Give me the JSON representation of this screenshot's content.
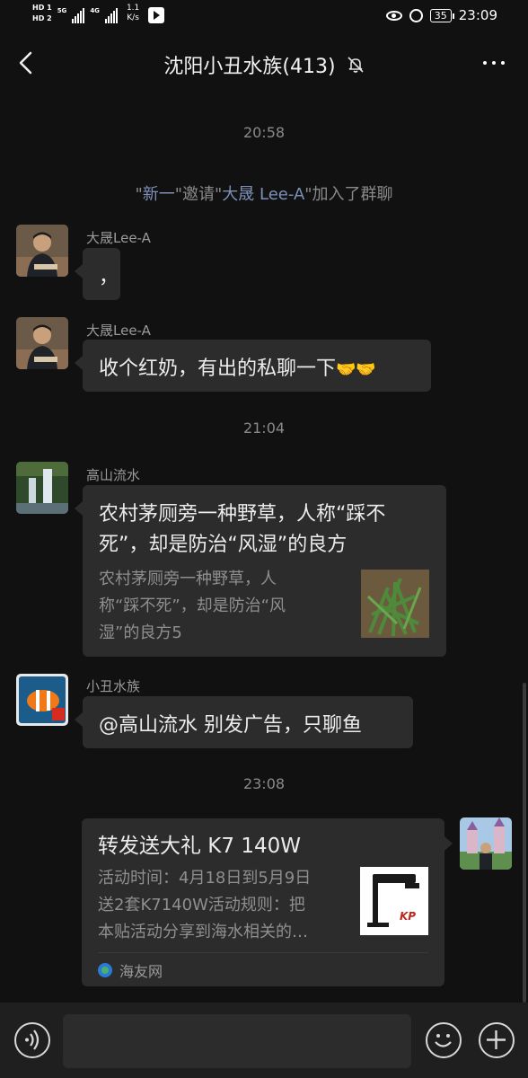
{
  "status_bar": {
    "sim1": "HD 1",
    "sim2": "HD 2",
    "net1": "5G",
    "net2": "4G",
    "speed_value": "1.1",
    "speed_unit": "K/s",
    "battery": "35",
    "time": "23:09"
  },
  "header": {
    "title": "沈阳小丑水族(413)",
    "icons": [
      "back-arrow-icon",
      "mute-bell-icon",
      "more-icon"
    ]
  },
  "chat": {
    "time_1": "20:58",
    "system_message": {
      "q1": "\"",
      "inviter": "新一",
      "mid": "\"邀请\"",
      "invitee": "大晟 Lee-A",
      "tail": "\"加入了群聊"
    },
    "msg_1": {
      "sender": "大晟Lee-A",
      "text": "，"
    },
    "msg_2": {
      "sender": "大晟Lee-A",
      "text": "收个红奶，有出的私聊一下",
      "emoji": "🤝🤝"
    },
    "time_2": "21:04",
    "msg_3": {
      "sender": "高山流水",
      "card_title_1": "农村茅厕旁一种野草，人称“踩不",
      "card_title_2": "死”，却是防治“风湿”的良方",
      "card_desc_1": "农村茅厕旁一种野草，人",
      "card_desc_2": "称“踩不死”，却是防治“风",
      "card_desc_3": "湿”的良方5"
    },
    "msg_4": {
      "sender": "小丑水族",
      "text": "@高山流水  别发广告，只聊鱼"
    },
    "time_3": "23:08",
    "msg_5": {
      "card_title": "转发送大礼 K7 140W",
      "card_desc_1": "活动时间：4月18日到5月9日",
      "card_desc_2": "送2套K7140W活动规则：把",
      "card_desc_3": "本贴活动分享到海水相关的…",
      "source": "海友网",
      "thumb_text": "KP"
    }
  },
  "input_bar": {
    "icons": [
      "voice-icon",
      "emoji-icon",
      "plus-icon"
    ]
  },
  "colors": {
    "background": "#111111",
    "bubble": "#2c2c2c",
    "link": "#7d90b7",
    "muted": "#8a8a8a"
  }
}
